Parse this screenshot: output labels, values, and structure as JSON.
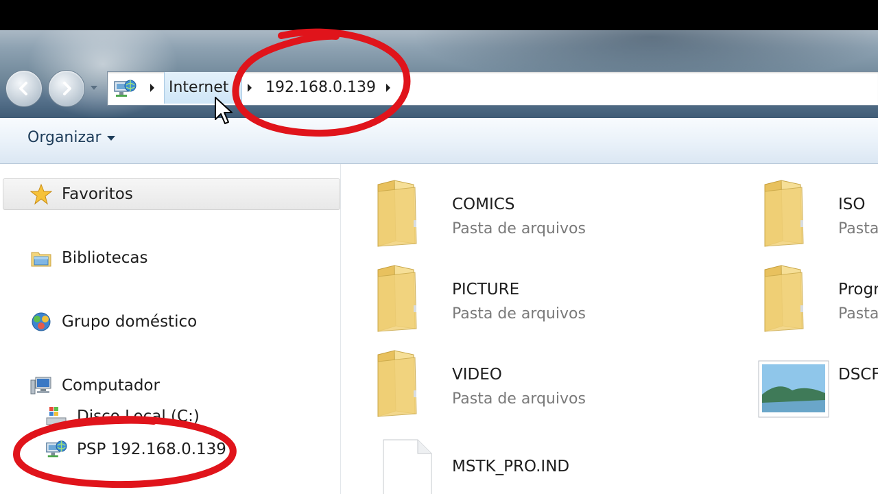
{
  "address_bar": {
    "crumbs": [
      "Internet",
      "192.168.0.139"
    ]
  },
  "toolbar": {
    "organize_label": "Organizar"
  },
  "nav_pane": {
    "favorites": "Favoritos",
    "libraries": "Bibliotecas",
    "homegroup": "Grupo doméstico",
    "computer": "Computador",
    "local_disk": "Disco Local (C:)",
    "network_share": "PSP 192.168.0.139"
  },
  "files": [
    {
      "name": "COMICS",
      "type": "Pasta de arquivos",
      "icon": "folder-icon"
    },
    {
      "name": "ISO",
      "type": "Pasta de arquivos",
      "icon": "folder-icon"
    },
    {
      "name": "PICTURE",
      "type": "Pasta de arquivos",
      "icon": "folder-icon"
    },
    {
      "name": "Programs",
      "type": "Pasta de arquivos",
      "icon": "folder-icon"
    },
    {
      "name": "VIDEO",
      "type": "Pasta de arquivos",
      "icon": "folder-icon"
    },
    {
      "name": "DSCF",
      "type": "",
      "icon": "image-file-icon"
    },
    {
      "name": "MSTK_PRO.IND",
      "type": "",
      "icon": "file-icon"
    }
  ],
  "colors": {
    "annotation_red": "#e0141b",
    "folder_yellow": "#f1d27a"
  }
}
